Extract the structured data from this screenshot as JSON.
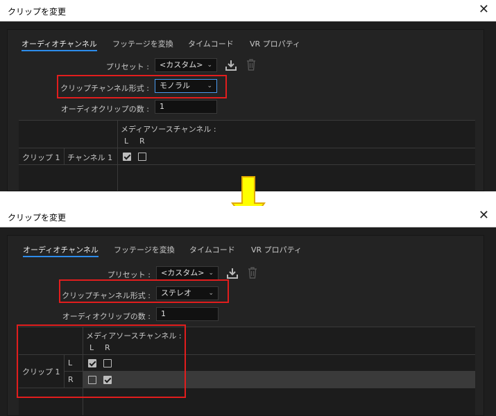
{
  "dialog": {
    "title": "クリップを変更",
    "close_glyph": "✕",
    "tabs": [
      "オーディオチャンネル",
      "フッテージを変換",
      "タイムコード",
      "VR プロパティ"
    ],
    "preset_label": "プリセット :",
    "preset_value": "<カスタム>",
    "clip_channel_format_label": "クリップチャンネル形式 :",
    "audio_clip_count_label": "オーディオクリップの数 :",
    "audio_clip_count_value": "1",
    "media_source_channel_header": "メディアソースチャンネル :",
    "col_l": "L",
    "col_r": "R",
    "clip_label": "クリップ 1"
  },
  "before": {
    "format_value": "モノラル",
    "channel_label": "チャンネル 1",
    "rows": [
      {
        "l": true,
        "r": false
      }
    ]
  },
  "after": {
    "format_value": "ステレオ",
    "row_labels": [
      "L",
      "R"
    ],
    "rows": [
      {
        "l": true,
        "r": false
      },
      {
        "l": false,
        "r": true
      }
    ]
  },
  "icons": {
    "import_preset": "download-icon",
    "delete_preset": "trash-icon",
    "transition": "down-arrow-icon"
  },
  "colors": {
    "highlight_box": "#e21d1d",
    "arrow_fill": "#ffff00",
    "arrow_stroke": "#e0a800",
    "tab_underline": "#2d8ceb"
  }
}
